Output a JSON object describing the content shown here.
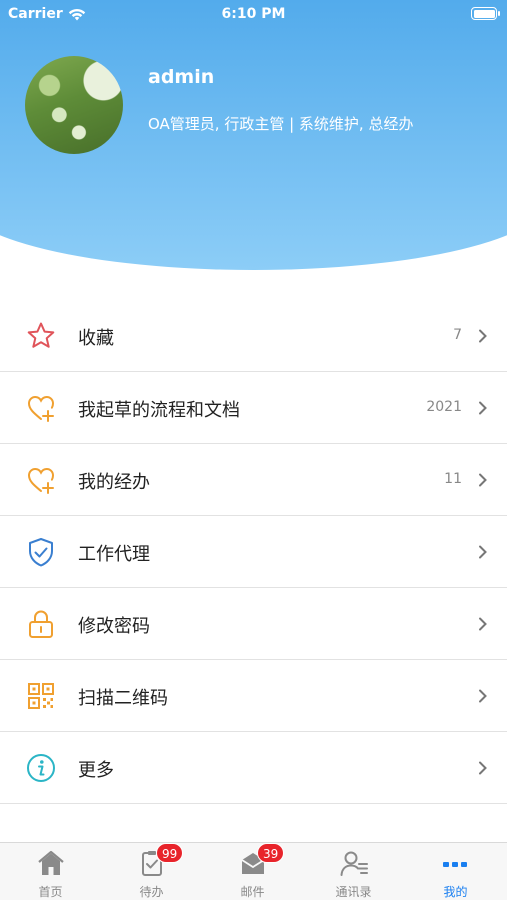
{
  "status_bar": {
    "carrier": "Carrier",
    "time": "6:10 PM"
  },
  "profile": {
    "username": "admin",
    "role": "OA管理员, 行政主管 | 系统维护, 总经办"
  },
  "menu": [
    {
      "label": "收藏",
      "count": "7",
      "icon": "star-icon"
    },
    {
      "label": "我起草的流程和文档",
      "count": "2021",
      "icon": "heart-plus-icon"
    },
    {
      "label": "我的经办",
      "count": "11",
      "icon": "heart-plus-icon"
    },
    {
      "label": "工作代理",
      "count": "",
      "icon": "shield-check-icon"
    },
    {
      "label": "修改密码",
      "count": "",
      "icon": "lock-icon"
    },
    {
      "label": "扫描二维码",
      "count": "",
      "icon": "qr-code-icon"
    },
    {
      "label": "更多",
      "count": "",
      "icon": "info-icon"
    }
  ],
  "tabbar": {
    "tabs": [
      {
        "label": "首页",
        "icon": "home-icon",
        "badge": ""
      },
      {
        "label": "待办",
        "icon": "todo-icon",
        "badge": "99"
      },
      {
        "label": "邮件",
        "icon": "mail-icon",
        "badge": "39"
      },
      {
        "label": "通讯录",
        "icon": "contacts-icon",
        "badge": ""
      },
      {
        "label": "我的",
        "icon": "more-dots-icon",
        "badge": ""
      }
    ],
    "active": "我的"
  },
  "colors": {
    "header_top": "#1e87dd",
    "header_bottom": "#8ccdf7",
    "active_tab": "#1a7ff0",
    "badge": "#e8242b",
    "star": "#e0545a",
    "orange": "#f0a030",
    "blue_icon": "#3a7fd0",
    "teal_icon": "#2bb5c6"
  }
}
